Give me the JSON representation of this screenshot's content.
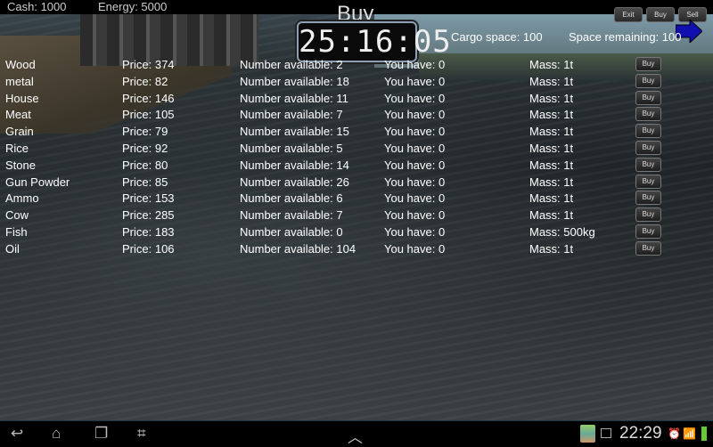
{
  "header": {
    "cash": "Cash: 1000",
    "energy": "Energy: 5000",
    "title": "Buy",
    "clock": "25:16:05",
    "buttons": {
      "exit": "Exit",
      "buy": "Buy",
      "sell": "Sell"
    },
    "cargo_space": "Cargo space: 100",
    "space_remaining": "Space remaining: 100"
  },
  "goods": [
    {
      "name": "Wood",
      "price": "Price: 374",
      "available": "Number available: 2",
      "have": "You have: 0",
      "mass": "Mass: 1t",
      "button": "Buy"
    },
    {
      "name": "metal",
      "price": "Price: 82",
      "available": "Number available: 18",
      "have": "You have: 0",
      "mass": "Mass: 1t",
      "button": "Buy"
    },
    {
      "name": "House",
      "price": "Price: 146",
      "available": "Number available: 11",
      "have": "You have: 0",
      "mass": "Mass: 1t",
      "button": "Buy"
    },
    {
      "name": "Meat",
      "price": "Price: 105",
      "available": "Number available: 7",
      "have": "You have: 0",
      "mass": "Mass: 1t",
      "button": "Buy"
    },
    {
      "name": "Grain",
      "price": "Price: 79",
      "available": "Number available: 15",
      "have": "You have: 0",
      "mass": "Mass: 1t",
      "button": "Buy"
    },
    {
      "name": "Rice",
      "price": "Price: 92",
      "available": "Number available: 5",
      "have": "You have: 0",
      "mass": "Mass: 1t",
      "button": "Buy"
    },
    {
      "name": "Stone",
      "price": "Price: 80",
      "available": "Number available: 14",
      "have": "You have: 0",
      "mass": "Mass: 1t",
      "button": "Buy"
    },
    {
      "name": "Gun Powder",
      "price": "Price: 85",
      "available": "Number available: 26",
      "have": "You have: 0",
      "mass": "Mass: 1t",
      "button": "Buy"
    },
    {
      "name": "Ammo",
      "price": "Price: 153",
      "available": "Number available: 6",
      "have": "You have: 0",
      "mass": "Mass: 1t",
      "button": "Buy"
    },
    {
      "name": "Cow",
      "price": "Price: 285",
      "available": "Number available: 7",
      "have": "You have: 0",
      "mass": "Mass: 1t",
      "button": "Buy"
    },
    {
      "name": "Fish",
      "price": "Price: 183",
      "available": "Number available: 0",
      "have": "You have: 0",
      "mass": "Mass: 500kg",
      "button": "Buy"
    },
    {
      "name": "Oil",
      "price": "Price: 106",
      "available": "Number available: 104",
      "have": "You have: 0",
      "mass": "Mass: 1t",
      "button": "Buy"
    }
  ],
  "statusbar": {
    "time": "22:29",
    "icons": [
      "back-icon",
      "home-icon",
      "recent-apps-icon",
      "screenshot-icon",
      "up-chevron-icon",
      "app-notification-icon",
      "image-icon",
      "alarm-icon",
      "wifi-icon",
      "battery-icon"
    ]
  },
  "colors": {
    "arrow": "#1010b0",
    "text": "#ffffff"
  }
}
